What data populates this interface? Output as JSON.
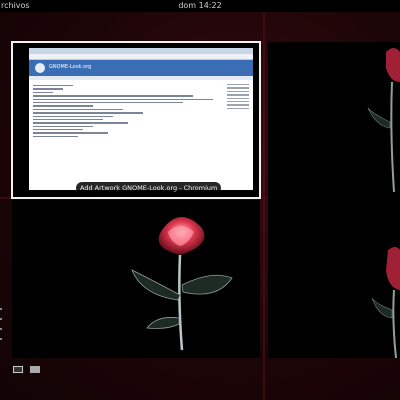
{
  "topbar": {
    "activities_label": "rchivos",
    "clock": "dom 14:22"
  },
  "overview": {
    "window_caption": "Add Artwork GNOME-Look.org - Chromium",
    "browser_site_title": "GNOME-Look.org"
  },
  "colors": {
    "wallpaper": "#1c0507",
    "panel": "#000000",
    "thumb_border": "#f2f2f2",
    "rose": "#e23a52",
    "stem": "#b8c8c8"
  },
  "workspace_icons": [
    "workspace-grid-icon",
    "workspace-single-icon"
  ]
}
